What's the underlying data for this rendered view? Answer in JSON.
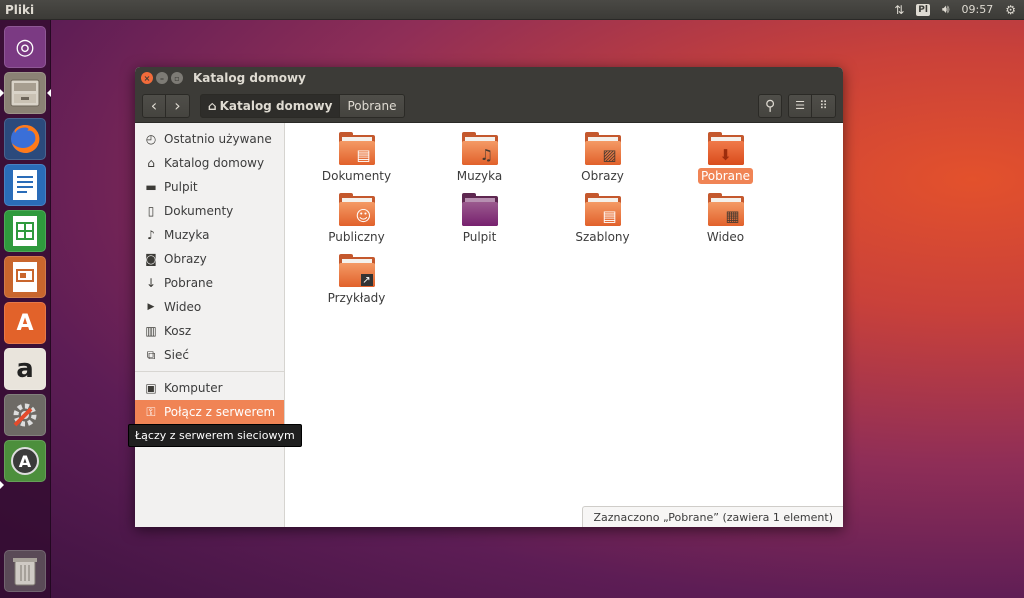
{
  "panel": {
    "app_title": "Pliki",
    "keyboard_layout": "Pl",
    "clock": "09:57",
    "icons": [
      "network-arrows-icon",
      "volume-icon",
      "settings-gear-icon"
    ]
  },
  "launcher": {
    "items": [
      {
        "name": "ubuntu-dash",
        "icon": "ubuntu-logo-icon"
      },
      {
        "name": "files",
        "icon": "files-drawer-icon"
      },
      {
        "name": "firefox",
        "icon": "firefox-icon"
      },
      {
        "name": "writer",
        "icon": "libreoffice-writer-icon"
      },
      {
        "name": "calc",
        "icon": "libreoffice-calc-icon"
      },
      {
        "name": "impress",
        "icon": "libreoffice-impress-icon"
      },
      {
        "name": "software",
        "icon": "software-center-icon"
      },
      {
        "name": "amazon",
        "icon": "amazon-icon"
      },
      {
        "name": "system-settings",
        "icon": "system-settings-icon"
      },
      {
        "name": "software-updater",
        "icon": "software-updater-icon"
      },
      {
        "name": "trash",
        "icon": "trash-icon"
      }
    ],
    "glyphs": {
      "dash": "◎",
      "amazon": "a",
      "software": "A",
      "updater": "A"
    }
  },
  "window": {
    "title": "Katalog domowy",
    "nav": {
      "back": "‹",
      "forward": "›"
    },
    "path": {
      "home_icon": "⌂",
      "current": "Katalog domowy",
      "next": "Pobrane"
    },
    "toolbar_icons": {
      "search": "⚲",
      "list": "☰",
      "grid": "⠿"
    }
  },
  "sidebar": {
    "places": [
      {
        "label": "Ostatnio używane",
        "icon": "clock-icon",
        "glyph": "◴"
      },
      {
        "label": "Katalog domowy",
        "icon": "home-icon",
        "glyph": "⌂"
      },
      {
        "label": "Pulpit",
        "icon": "desktop-icon",
        "glyph": "▬"
      },
      {
        "label": "Dokumenty",
        "icon": "document-icon",
        "glyph": "▯"
      },
      {
        "label": "Muzyka",
        "icon": "music-icon",
        "glyph": "♪"
      },
      {
        "label": "Obrazy",
        "icon": "camera-icon",
        "glyph": "◙"
      },
      {
        "label": "Pobrane",
        "icon": "download-icon",
        "glyph": "↓"
      },
      {
        "label": "Wideo",
        "icon": "video-icon",
        "glyph": "▶"
      },
      {
        "label": "Kosz",
        "icon": "trash-icon",
        "glyph": "▥"
      },
      {
        "label": "Sieć",
        "icon": "network-icon",
        "glyph": "⧉"
      }
    ],
    "devices": [
      {
        "label": "Komputer",
        "icon": "computer-icon",
        "glyph": "▣"
      },
      {
        "label": "Połącz z serwerem",
        "icon": "server-icon",
        "glyph": "⚿",
        "selected": true
      }
    ]
  },
  "files": [
    {
      "label": "Dokumenty",
      "emblem": "▤",
      "emblem_name": "document-emblem-icon"
    },
    {
      "label": "Muzyka",
      "emblem": "♫",
      "emblem_name": "music-emblem-icon"
    },
    {
      "label": "Obrazy",
      "emblem": "▨",
      "emblem_name": "picture-emblem-icon"
    },
    {
      "label": "Pobrane",
      "emblem": "⬇",
      "emblem_name": "download-emblem-icon",
      "selected": true
    },
    {
      "label": "Publiczny",
      "emblem": "☺",
      "emblem_name": "public-emblem-icon"
    },
    {
      "label": "Pulpit",
      "emblem": "",
      "emblem_name": "desktop-emblem-icon",
      "purple": true
    },
    {
      "label": "Szablony",
      "emblem": "▤",
      "emblem_name": "template-emblem-icon"
    },
    {
      "label": "Wideo",
      "emblem": "▦",
      "emblem_name": "video-emblem-icon"
    },
    {
      "label": "Przykłady",
      "emblem": "↗",
      "emblem_name": "link-emblem-icon"
    }
  ],
  "status": "Zaznaczono „Pobrane” (zawiera 1 element)",
  "tooltip": "Łączy z serwerem sieciowym"
}
